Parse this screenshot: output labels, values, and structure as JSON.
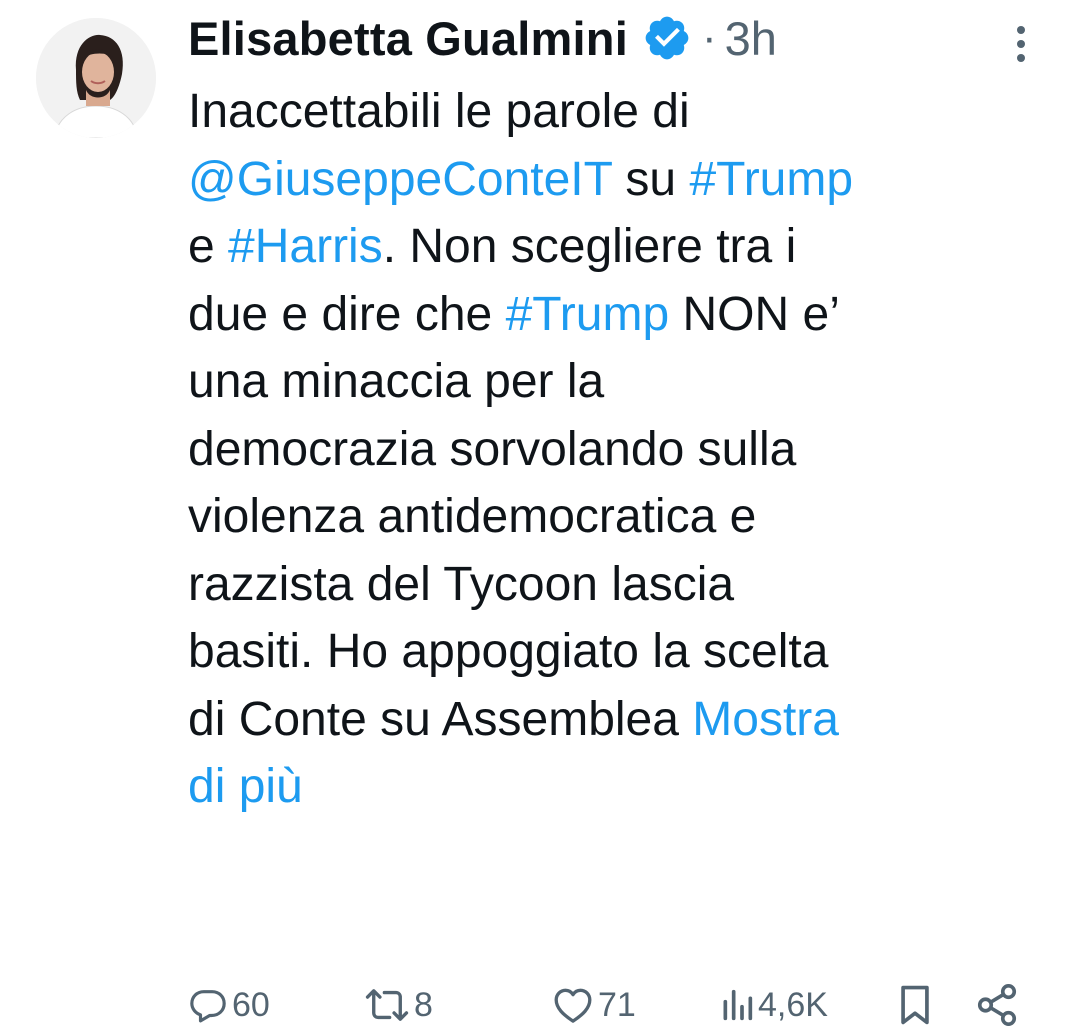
{
  "tweet": {
    "author_name": "Elisabetta Gualmini",
    "separator": "·",
    "time": "3h",
    "lines": [
      [
        {
          "text": "Inaccettabili le parole di",
          "link": false
        }
      ],
      [
        {
          "text": "@GiuseppeConteIT",
          "link": true
        },
        {
          "text": " su ",
          "link": false
        },
        {
          "text": "#Trump",
          "link": true
        }
      ],
      [
        {
          "text": "e ",
          "link": false
        },
        {
          "text": "#Harris",
          "link": true
        },
        {
          "text": ". Non scegliere tra i",
          "link": false
        }
      ],
      [
        {
          "text": "due e dire che ",
          "link": false
        },
        {
          "text": "#Trump",
          "link": true
        },
        {
          "text": " NON e’",
          "link": false
        }
      ],
      [
        {
          "text": "una minaccia per la",
          "link": false
        }
      ],
      [
        {
          "text": "democrazia sorvolando sulla",
          "link": false
        }
      ],
      [
        {
          "text": "violenza antidemocratica e",
          "link": false
        }
      ],
      [
        {
          "text": "razzista del Tycoon lascia",
          "link": false
        }
      ],
      [
        {
          "text": "basiti. Ho appoggiato la scelta",
          "link": false
        }
      ],
      [
        {
          "text": "di Conte su Assemblea ",
          "link": false
        },
        {
          "text": "Mostra",
          "link": true
        }
      ],
      [
        {
          "text": "di più",
          "link": true
        }
      ]
    ]
  },
  "actions": {
    "replies": "60",
    "reposts": "8",
    "likes": "71",
    "views": "4,6K"
  },
  "icons": {
    "verified": "verified-badge-icon",
    "more": "more-vertical-icon",
    "reply": "reply-icon",
    "repost": "repost-icon",
    "like": "heart-icon",
    "views": "views-icon",
    "bookmark": "bookmark-icon",
    "share": "share-icon"
  },
  "colors": {
    "text": "#0f1419",
    "muted": "#536471",
    "link": "#1d9bf0",
    "verified": "#1d9bf0"
  }
}
